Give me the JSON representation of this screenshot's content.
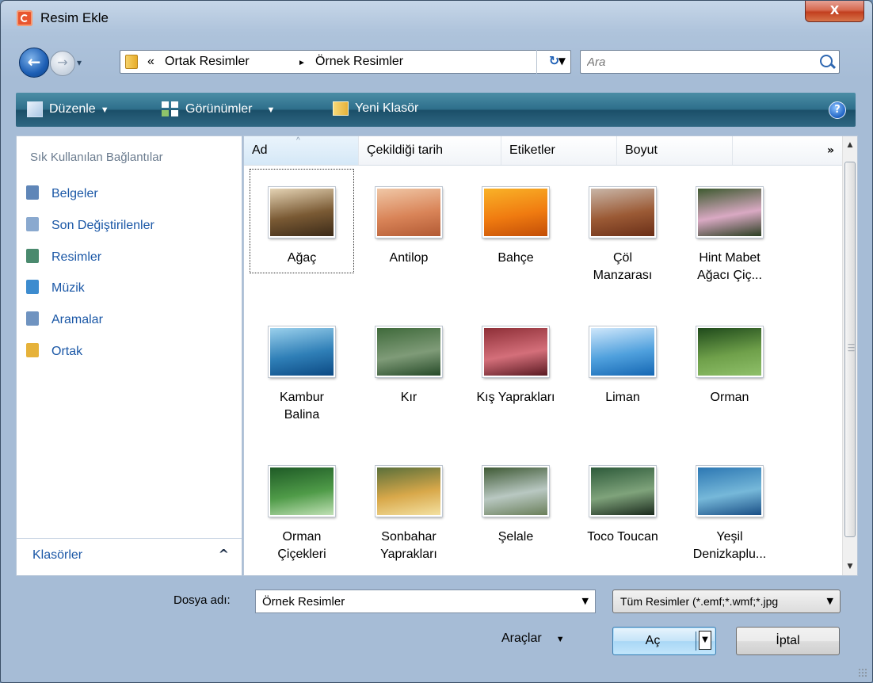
{
  "window": {
    "title": "Resim Ekle",
    "close_label": "X"
  },
  "navigation": {
    "back_symbol": "←",
    "forward_symbol": "→",
    "history_symbol": "▾",
    "overflow_symbol": "«",
    "breadcrumbs": [
      "Ortak Resimler",
      "Örnek Resimler"
    ],
    "separator": "►",
    "dropdown_symbol": "▼",
    "refresh_symbol": "↻"
  },
  "search": {
    "placeholder": "Ara"
  },
  "toolbar": {
    "organize": "Düzenle",
    "views": "Görünümler",
    "new_folder": "Yeni Klasör",
    "arrow": "▼",
    "help": "?"
  },
  "nav_pane": {
    "header": "Sık Kullanılan Bağlantılar",
    "items": [
      {
        "label": "Belgeler",
        "icon": "documents-icon",
        "color": "#5f86b8"
      },
      {
        "label": "Son Değiştirilenler",
        "icon": "recent-icon",
        "color": "#8aa9cf"
      },
      {
        "label": "Resimler",
        "icon": "pictures-icon",
        "color": "#4a8a6e"
      },
      {
        "label": "Müzik",
        "icon": "music-icon",
        "color": "#3d8ccf"
      },
      {
        "label": "Aramalar",
        "icon": "searches-icon",
        "color": "#6f93c0"
      },
      {
        "label": "Ortak",
        "icon": "folder-icon",
        "color": "#e6b23a"
      }
    ],
    "footer": "Klasörler",
    "footer_chevron": "^"
  },
  "columns": {
    "headers": [
      "Ad",
      "Çekildiği tarih",
      "Etiketler",
      "Boyut"
    ],
    "sort_caret": "^",
    "more": "»"
  },
  "files": [
    {
      "lines": [
        "Ağaç"
      ],
      "selected": true,
      "colors": [
        "#e4d3b4",
        "#7a5a34",
        "#3b2a18"
      ]
    },
    {
      "lines": [
        "Antilop"
      ],
      "selected": false,
      "colors": [
        "#f0c7a6",
        "#d98458",
        "#b25a34"
      ]
    },
    {
      "lines": [
        "Bahçe"
      ],
      "selected": false,
      "colors": [
        "#f9b228",
        "#f07b10",
        "#c24e08"
      ]
    },
    {
      "lines": [
        "Çöl",
        "Manzarası"
      ],
      "selected": false,
      "colors": [
        "#c9b6a8",
        "#9b5a35",
        "#6a2f18"
      ]
    },
    {
      "lines": [
        "Hint Mabet",
        "Ağacı Çiç..."
      ],
      "selected": false,
      "colors": [
        "#3d5a2f",
        "#d9a9c3",
        "#2b3f22"
      ]
    },
    {
      "lines": [
        "Kambur",
        "Balina"
      ],
      "selected": false,
      "colors": [
        "#9ad0ec",
        "#2f7fb7",
        "#0c4a84"
      ]
    },
    {
      "lines": [
        "Kır"
      ],
      "selected": false,
      "colors": [
        "#3f6a3b",
        "#7f9b78",
        "#264a28"
      ]
    },
    {
      "lines": [
        "Kış Yaprakları"
      ],
      "selected": false,
      "colors": [
        "#8e2f37",
        "#d46f7a",
        "#5a1a22"
      ]
    },
    {
      "lines": [
        "Liman"
      ],
      "selected": false,
      "colors": [
        "#cfe7fb",
        "#4fa0dd",
        "#1567b3"
      ]
    },
    {
      "lines": [
        "Orman"
      ],
      "selected": false,
      "colors": [
        "#1f4a1b",
        "#6fa04a",
        "#8fc06a"
      ]
    },
    {
      "lines": [
        "Orman",
        "Çiçekleri"
      ],
      "selected": false,
      "colors": [
        "#1e5a26",
        "#4f9b48",
        "#bfe0b4"
      ]
    },
    {
      "lines": [
        "Sonbahar",
        "Yaprakları"
      ],
      "selected": false,
      "colors": [
        "#5a6f3a",
        "#d8a84a",
        "#f3e0a0"
      ]
    },
    {
      "lines": [
        "Şelale"
      ],
      "selected": false,
      "colors": [
        "#3f5a35",
        "#b9c8c2",
        "#6a7f5a"
      ]
    },
    {
      "lines": [
        "Toco Toucan"
      ],
      "selected": false,
      "colors": [
        "#2d5a3a",
        "#7fa37b",
        "#1b2a1d"
      ]
    },
    {
      "lines": [
        "Yeşil",
        "Denizkaplu..."
      ],
      "selected": false,
      "colors": [
        "#2c77b3",
        "#76b8d9",
        "#1a4f86"
      ]
    }
  ],
  "bottom": {
    "filename_label": "Dosya adı:",
    "filename_value": "Örnek Resimler",
    "filetype_value": "Tüm Resimler (*.emf;*.wmf;*.jpg",
    "tools": "Araçlar",
    "open": "Aç",
    "cancel": "İptal",
    "dropdown_symbol": "▼"
  }
}
